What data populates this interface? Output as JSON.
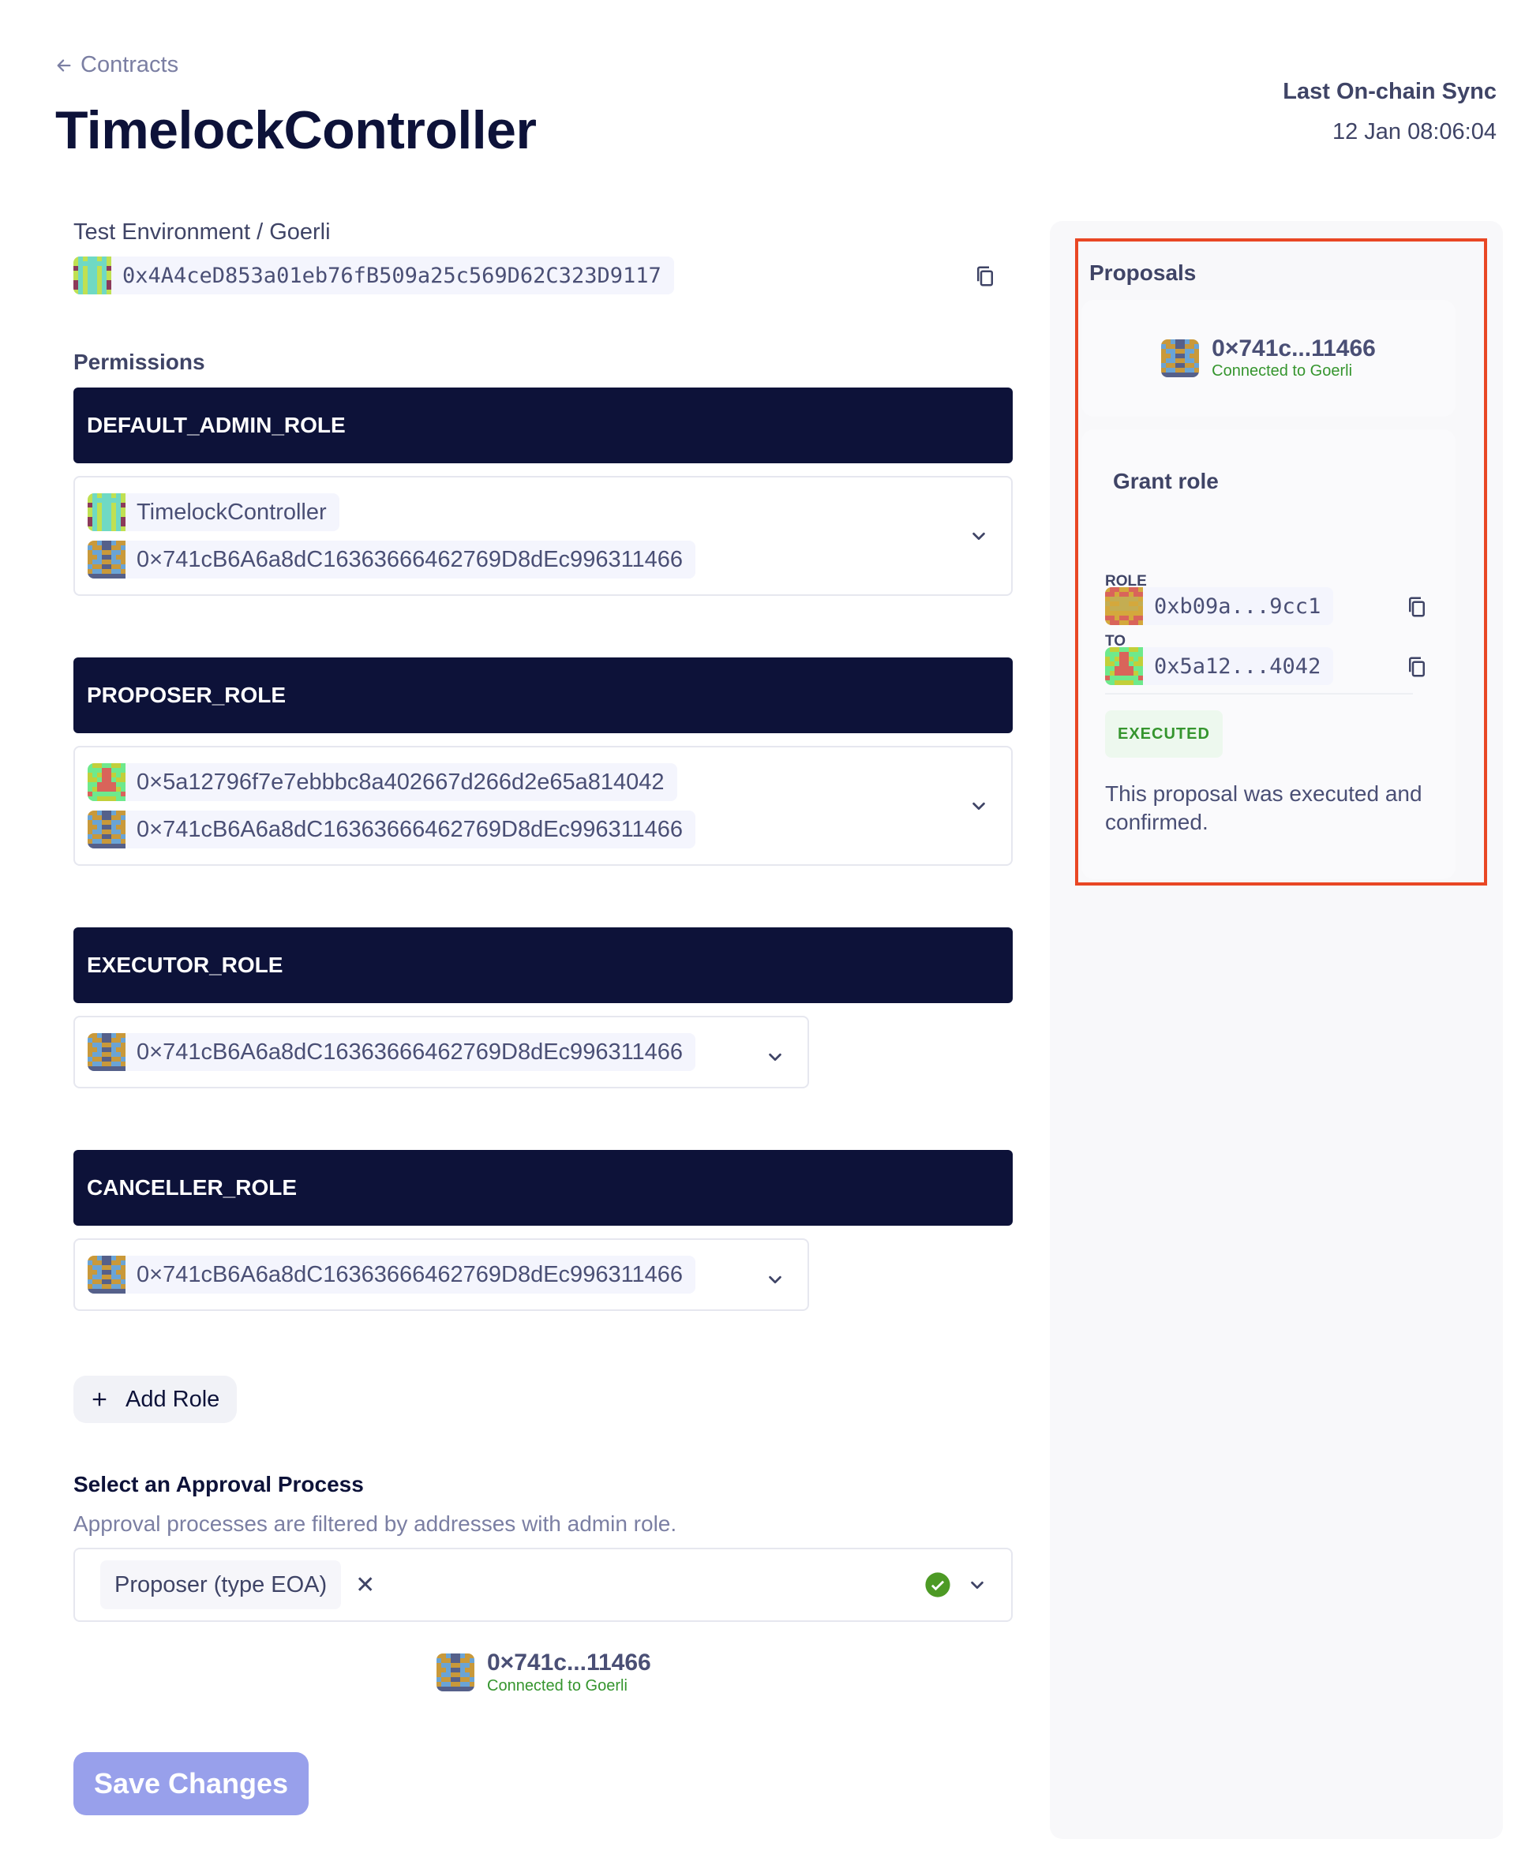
{
  "nav": {
    "back_label": "Contracts"
  },
  "header": {
    "title": "TimelockController",
    "sync_label": "Last On-chain Sync",
    "sync_value": "12 Jan 08:06:04"
  },
  "contract": {
    "environment": "Test Environment / Goerli",
    "address": "0x4A4ceD853a01eb76fB509a25c569D62C323D9117"
  },
  "permissions": {
    "label": "Permissions",
    "roles": [
      {
        "name": "DEFAULT_ADMIN_ROLE",
        "members": [
          "TimelockController",
          "0×741cB6A6a8dC16363666462769D8dEc996311466"
        ]
      },
      {
        "name": "PROPOSER_ROLE",
        "members": [
          "0×5a12796f7e7ebbbc8a402667d266d2e65a814042",
          "0×741cB6A6a8dC16363666462769D8dEc996311466"
        ]
      },
      {
        "name": "EXECUTOR_ROLE",
        "members": [
          "0×741cB6A6a8dC16363666462769D8dEc996311466"
        ]
      },
      {
        "name": "CANCELLER_ROLE",
        "members": [
          "0×741cB6A6a8dC16363666462769D8dEc996311466"
        ]
      }
    ],
    "add_role_label": "Add Role"
  },
  "approval": {
    "title": "Select an Approval Process",
    "subtitle": "Approval processes are filtered by addresses with admin role.",
    "selected": "Proposer (type EOA)",
    "remove_glyph": "✕"
  },
  "wallet": {
    "address": "0×741c...11466",
    "status": "Connected to Goerli"
  },
  "save_label": "Save Changes",
  "proposals": {
    "title": "Proposals",
    "wallet_address": "0×741c...11466",
    "wallet_status": "Connected to Goerli",
    "grant": {
      "title": "Grant role",
      "role_label": "ROLE",
      "role_value": "0xb09a...9cc1",
      "to_label": "TO",
      "to_value": "0x5a12...4042",
      "status": "EXECUTED",
      "description": "This proposal was executed and confirmed."
    }
  },
  "colors": {
    "navy": "#0d1239",
    "success": "#35952e",
    "highlight": "#e94724",
    "primary_disabled": "#98a0eb"
  }
}
